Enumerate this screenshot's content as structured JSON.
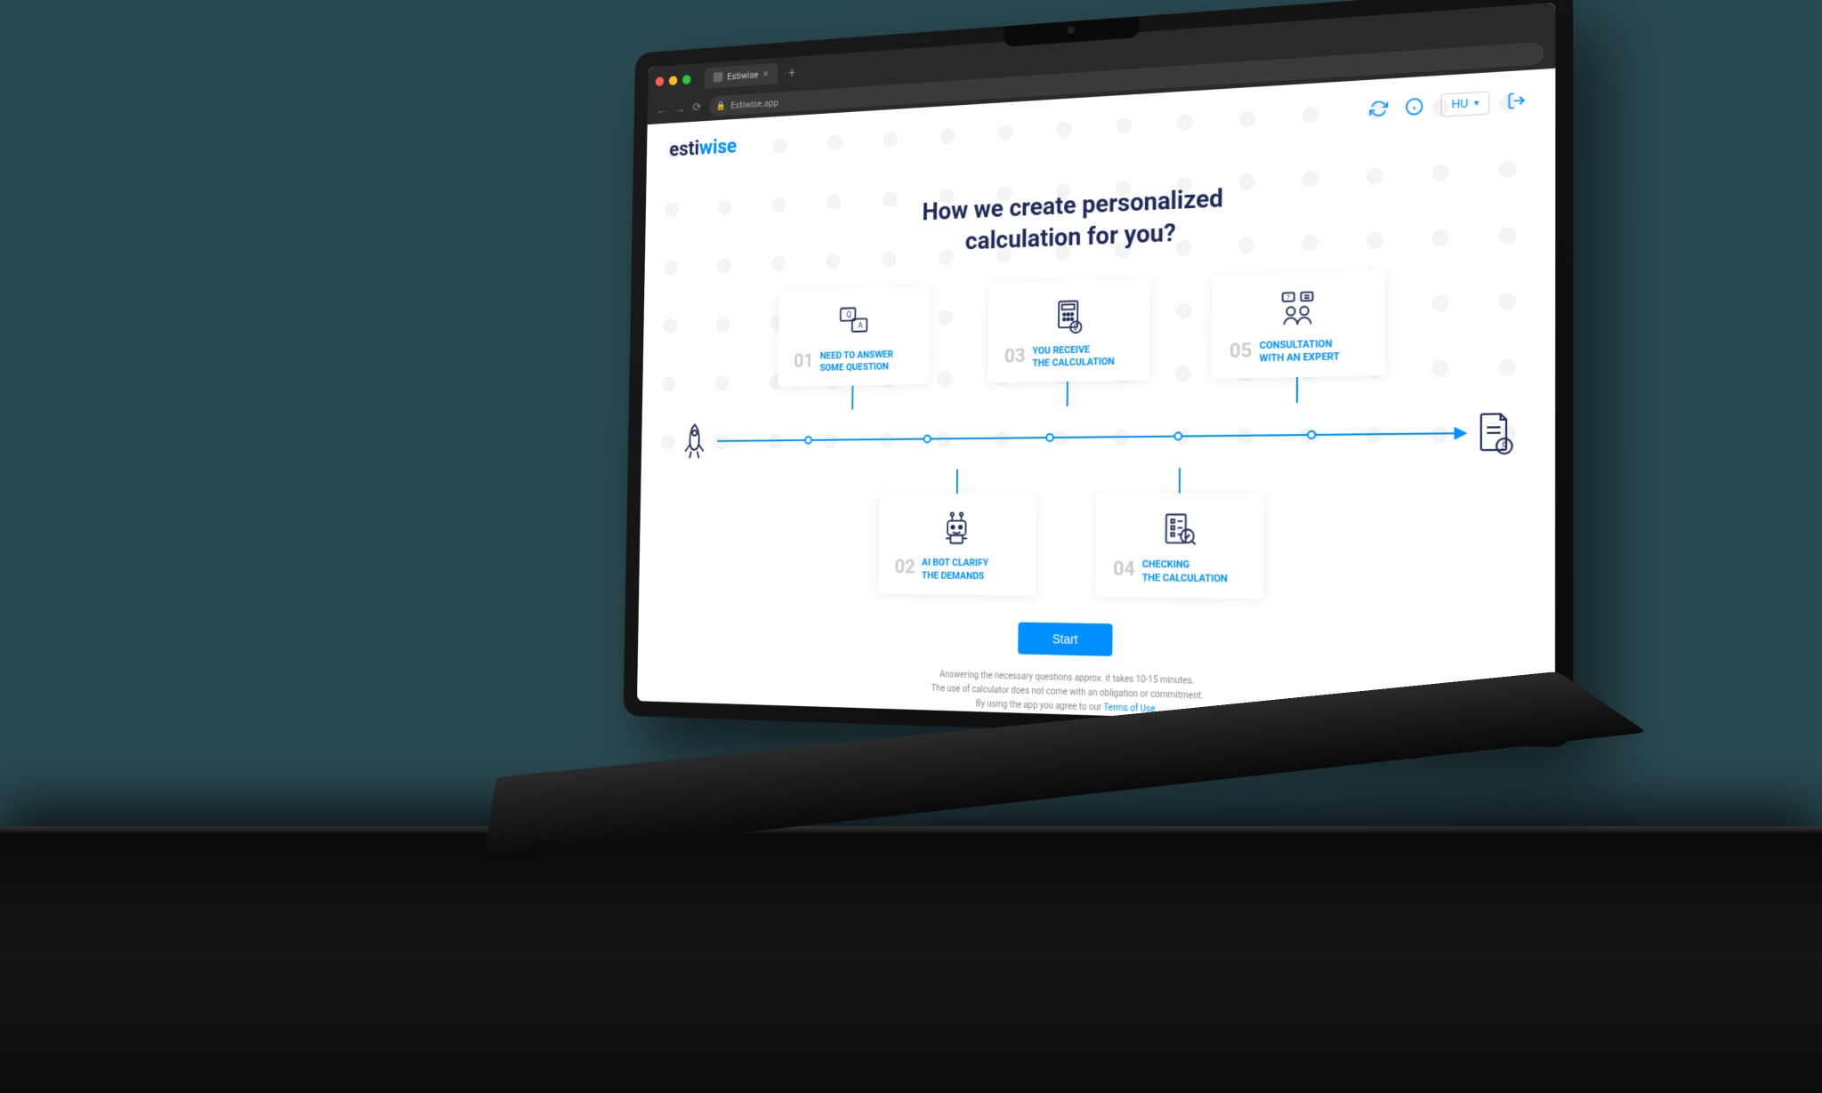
{
  "browser": {
    "tab_title": "Estiwise",
    "url": "Estiwise.app"
  },
  "header": {
    "logo_a": "esti",
    "logo_b": "wise",
    "lang": "HU"
  },
  "hero": {
    "title_line1": "How we create personalized",
    "title_line2": "calculation for you?"
  },
  "steps": [
    {
      "num": "01",
      "line1": "NEED TO ANSWER",
      "line2": "SOME QUESTION"
    },
    {
      "num": "02",
      "line1": "AI BOT CLARIFY",
      "line2": "THE DEMANDS"
    },
    {
      "num": "03",
      "line1": "YOU RECEIVE",
      "line2": "THE CALCULATION"
    },
    {
      "num": "04",
      "line1": "CHECKING",
      "line2": "THE CALCULATION"
    },
    {
      "num": "05",
      "line1": "CONSULTATION",
      "line2": "WITH AN EXPERT"
    }
  ],
  "cta": {
    "start": "Start"
  },
  "footer": {
    "line1": "Answering the necessary questions approx. it takes 10-15 minutes.",
    "line2": "The use of calculator does not come with an obligation or commitment.",
    "line3a": "By using the app you agree to our ",
    "terms": "Terms of Use"
  }
}
